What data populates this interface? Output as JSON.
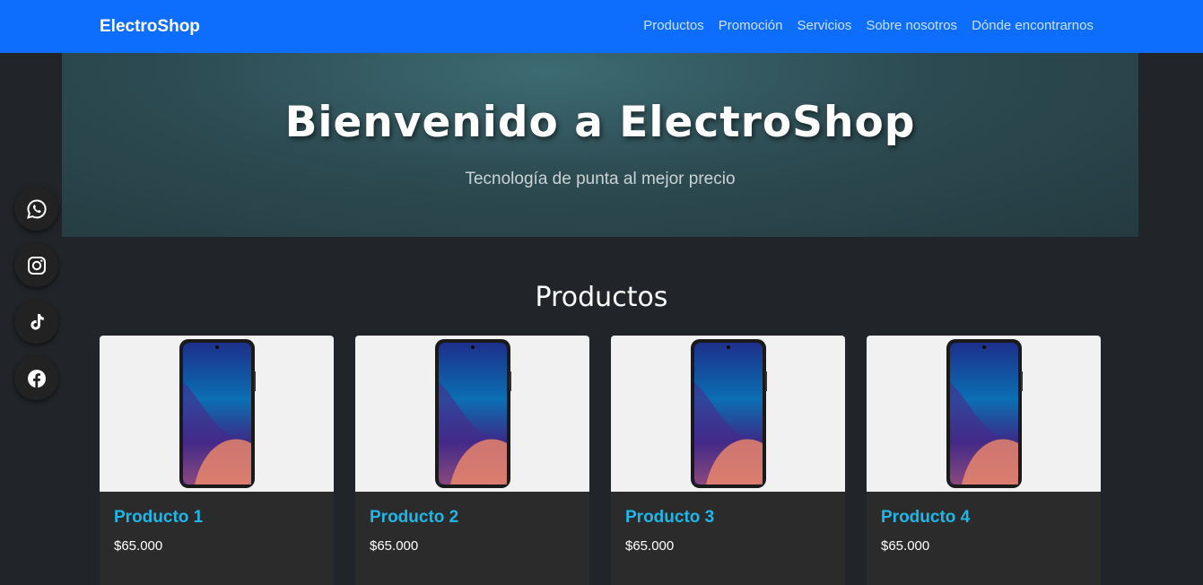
{
  "navbar": {
    "brand": "ElectroShop",
    "links": [
      "Productos",
      "Promoción",
      "Servicios",
      "Sobre nosotros",
      "Dónde encontrarnos"
    ],
    "color": "#0d6efd"
  },
  "hero": {
    "title": "Bienvenido a ElectroShop",
    "subtitle": "Tecnología de punta al mejor precio"
  },
  "products_section": {
    "title": "Productos",
    "items": [
      {
        "name": "Producto 1",
        "price": "$65.000"
      },
      {
        "name": "Producto 2",
        "price": "$65.000"
      },
      {
        "name": "Producto 3",
        "price": "$65.000"
      },
      {
        "name": "Producto 4",
        "price": "$65.000"
      }
    ]
  },
  "social": [
    "whatsapp-icon",
    "instagram-icon",
    "tiktok-icon",
    "facebook-icon"
  ],
  "colors": {
    "accent": "#1fb6e8",
    "background": "#212529",
    "card": "#2b2b2b"
  }
}
